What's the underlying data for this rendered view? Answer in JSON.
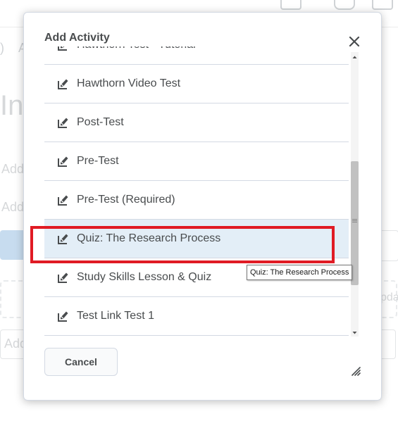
{
  "background": {
    "paren": ")",
    "crumb_letter": "A",
    "heading_fragment": "In",
    "add_text_1": "Add",
    "add_text_2": "Add",
    "right_fragment": "pda",
    "input_fragment": "Add"
  },
  "dialog": {
    "title": "Add Activity",
    "close_icon": "close-icon",
    "items": [
      {
        "label": "Hawthorn Test - Tutorial",
        "icon": "quiz-icon",
        "selected": false
      },
      {
        "label": "Hawthorn Video Test",
        "icon": "quiz-icon",
        "selected": false
      },
      {
        "label": "Post-Test",
        "icon": "quiz-icon",
        "selected": false
      },
      {
        "label": "Pre-Test",
        "icon": "quiz-icon",
        "selected": false
      },
      {
        "label": "Pre-Test (Required)",
        "icon": "quiz-icon",
        "selected": false
      },
      {
        "label": "Quiz: The Research Process",
        "icon": "quiz-icon",
        "selected": true
      },
      {
        "label": "Study Skills Lesson & Quiz",
        "icon": "quiz-icon",
        "selected": false
      },
      {
        "label": "Test Link Test 1",
        "icon": "quiz-icon",
        "selected": false
      }
    ],
    "cancel_label": "Cancel"
  },
  "tooltip": {
    "text": "Quiz: The Research Process"
  },
  "colors": {
    "highlight": "#e01b24",
    "selected_row": "#e3eef7",
    "text": "#494c4e"
  }
}
